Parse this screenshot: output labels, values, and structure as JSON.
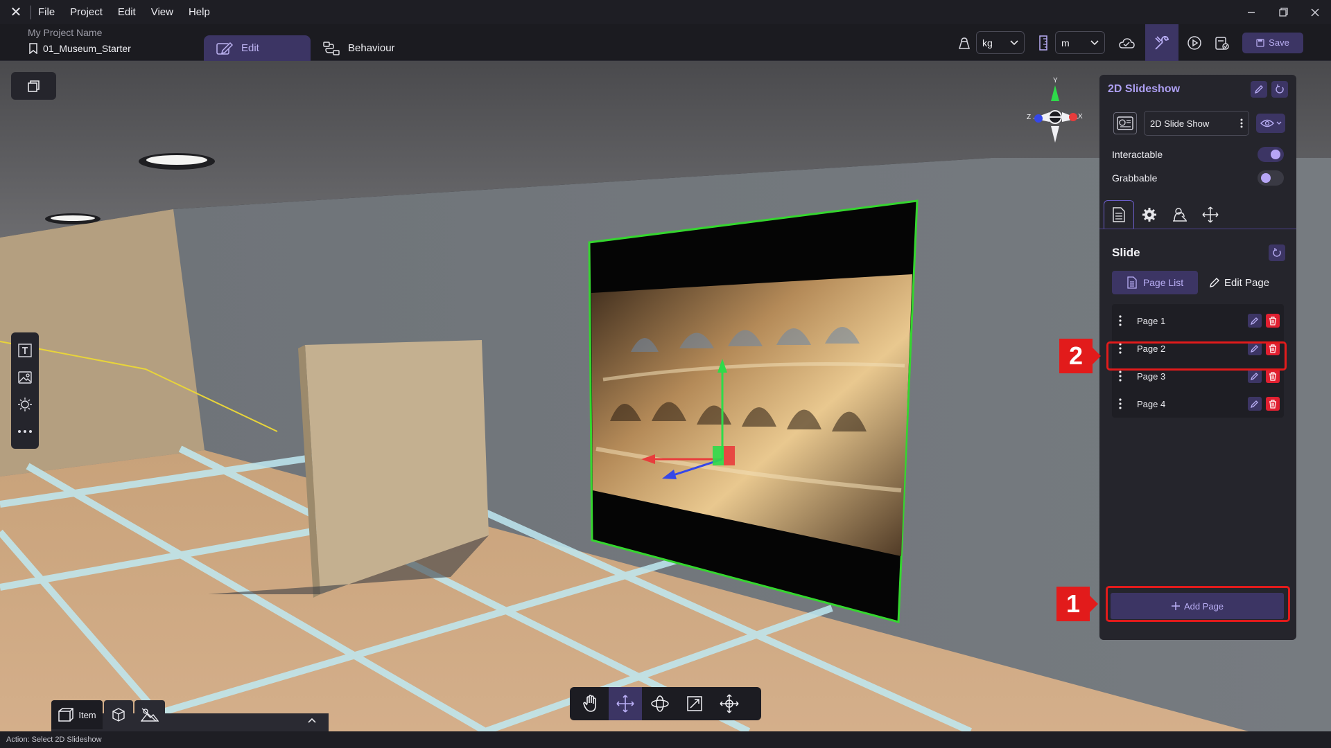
{
  "menubar": {
    "logo_icon": "app-logo-icon",
    "items": [
      "File",
      "Project",
      "Edit",
      "View",
      "Help"
    ],
    "window_controls": [
      "minimize",
      "restore",
      "close"
    ]
  },
  "project": {
    "name": "My Project Name",
    "scene": "01_Museum_Starter",
    "modes": {
      "edit": "Edit",
      "behaviour": "Behaviour"
    }
  },
  "toolbar": {
    "mass_unit": "kg",
    "length_unit": "m",
    "save_label": "Save"
  },
  "panel": {
    "title": "2D Slideshow",
    "object_type": "2D Slide Show",
    "interactable_label": "Interactable",
    "interactable_on": true,
    "grabbable_label": "Grabbable",
    "grabbable_on": false,
    "tabs": [
      "document",
      "settings",
      "appearance",
      "transform"
    ],
    "section_title": "Slide",
    "subtabs": {
      "page_list": "Page List",
      "edit_page": "Edit Page"
    },
    "pages": [
      "Page 1",
      "Page 2",
      "Page 3",
      "Page 4"
    ],
    "add_page_label": "Add Page"
  },
  "callouts": {
    "add_page": "1",
    "page_2": "2"
  },
  "gizmo": {
    "y": "Y",
    "z": "Z",
    "x": "X"
  },
  "transform_tools": [
    "hand",
    "move",
    "rotate",
    "scale",
    "transform"
  ],
  "active_transform_tool": "move",
  "dock": {
    "item_label": "Item"
  },
  "status": "Action: Select 2D Slideshow",
  "colors": {
    "accent": "#3c3564",
    "accent_text": "#b9aef5",
    "callout": "#e21b1b",
    "selection_outline": "#35d62f"
  }
}
